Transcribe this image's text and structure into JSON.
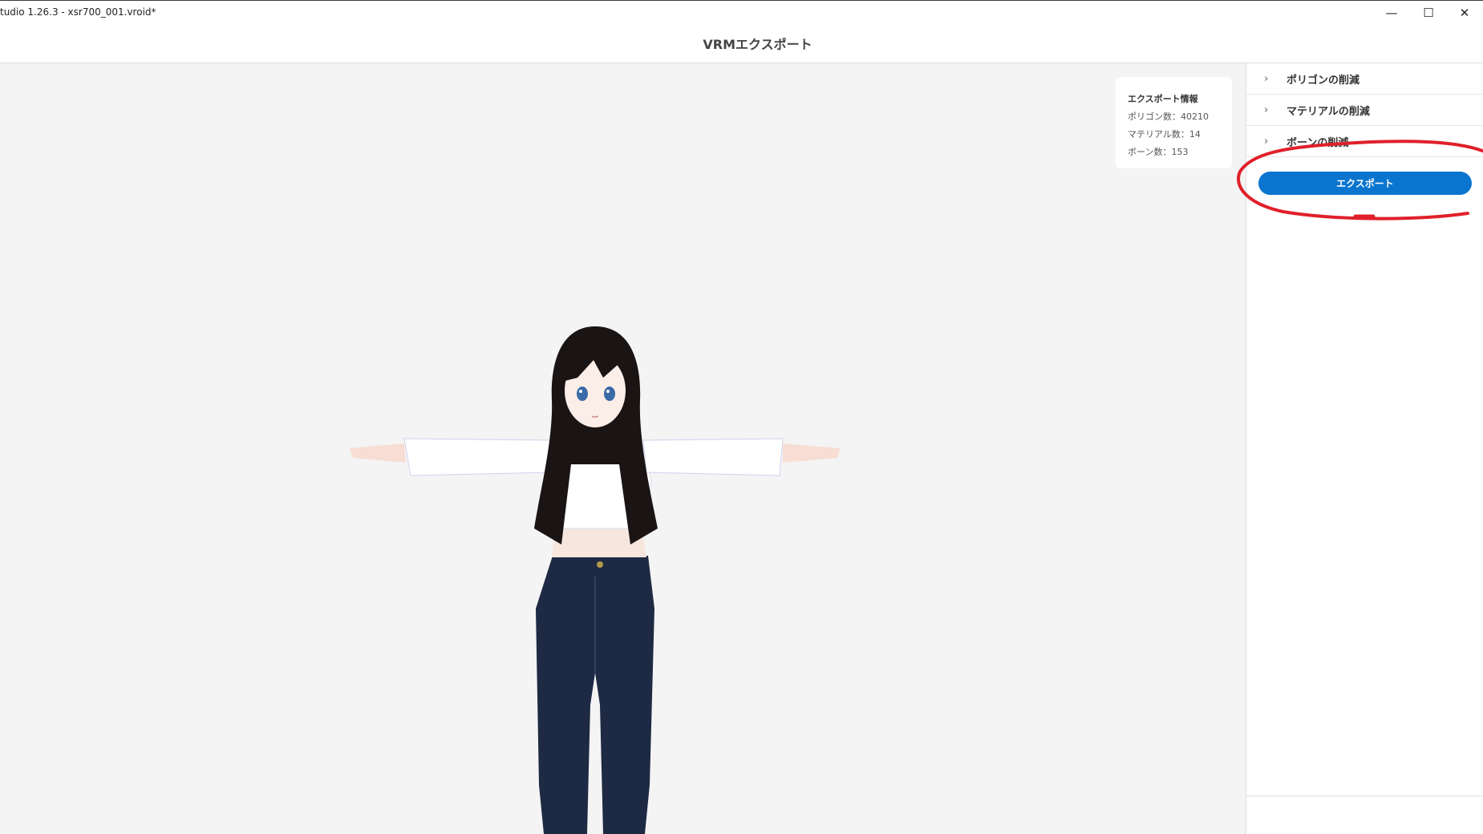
{
  "window": {
    "title": "tudio 1.26.3 - xsr700_001.vroid*",
    "minimize_glyph": "—",
    "maximize_glyph": "☐",
    "close_glyph": "✕"
  },
  "header": {
    "title": "VRMエクスポート"
  },
  "export_info": {
    "title": "エクスポート情報",
    "polygons": "ポリゴン数：40210",
    "materials": "マテリアル数：14",
    "bones": "ボーン数：153"
  },
  "panel": {
    "sections": [
      {
        "label": "ポリゴンの削減",
        "icon": "chevron-right-icon"
      },
      {
        "label": "マテリアルの削減",
        "icon": "chevron-right-icon"
      },
      {
        "label": "ボーンの削減",
        "icon": "chevron-right-icon"
      }
    ],
    "export_button": "エクスポート"
  },
  "colors": {
    "accent": "#0a75cf",
    "annotation": "#e0202a",
    "viewport_bg": "#f4f4f4"
  }
}
